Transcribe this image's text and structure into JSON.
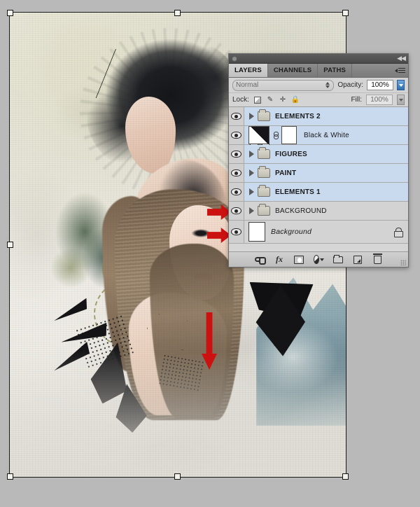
{
  "app": {
    "panel_title": "Layers Panel",
    "collapse_icon": "collapse-arrows-icon"
  },
  "tabs": [
    {
      "label": "LAYERS",
      "active": true
    },
    {
      "label": "CHANNELS",
      "active": false
    },
    {
      "label": "PATHS",
      "active": false
    }
  ],
  "options": {
    "blend_mode": "Normal",
    "opacity_label": "Opacity:",
    "opacity_value": "100%",
    "lock_label": "Lock:",
    "fill_label": "Fill:",
    "fill_value": "100%",
    "lock_icons": [
      "lock-transparent-pixels-icon",
      "lock-image-pixels-icon",
      "lock-position-icon",
      "lock-all-icon"
    ]
  },
  "layers": [
    {
      "name": "ELEMENTS 2",
      "type": "group",
      "selected": true,
      "visible": true
    },
    {
      "name": "Black & White",
      "type": "adjustment",
      "selected": true,
      "visible": true
    },
    {
      "name": "FIGURES",
      "type": "group",
      "selected": true,
      "visible": true
    },
    {
      "name": "PAINT",
      "type": "group",
      "selected": true,
      "visible": true
    },
    {
      "name": "ELEMENTS 1",
      "type": "group",
      "selected": true,
      "visible": true
    },
    {
      "name": "BACKGROUND",
      "type": "group",
      "selected": false,
      "visible": true
    },
    {
      "name": "Background",
      "type": "locked-layer",
      "selected": false,
      "visible": true
    }
  ],
  "footer_buttons": [
    {
      "name": "link-layers-button",
      "icon": "link-icon"
    },
    {
      "name": "layer-style-button",
      "icon": "fx-icon",
      "label": "fx"
    },
    {
      "name": "add-layer-mask-button",
      "icon": "mask-icon"
    },
    {
      "name": "new-adjustment-layer-button",
      "icon": "adjustment-icon"
    },
    {
      "name": "new-group-button",
      "icon": "folder-icon"
    },
    {
      "name": "new-layer-button",
      "icon": "new-layer-icon"
    },
    {
      "name": "delete-layer-button",
      "icon": "trash-icon"
    }
  ],
  "annotations": {
    "arrow_right_1": "red-arrow-pointing-at-background-group-visibility",
    "arrow_right_2": "red-arrow-pointing-at-background-layer-visibility",
    "arrow_down": "red-down-arrow-on-canvas"
  },
  "canvas": {
    "description": "Mixed-media photo composite artwork with two female figures, ink shards, mountains",
    "selection": "free-transform-handles"
  },
  "colors": {
    "accent_red": "#cc1111",
    "selected_row": "#c9d9ee",
    "panel_bg": "#d4d4d4",
    "workspace_bg": "#b9b9b9"
  }
}
